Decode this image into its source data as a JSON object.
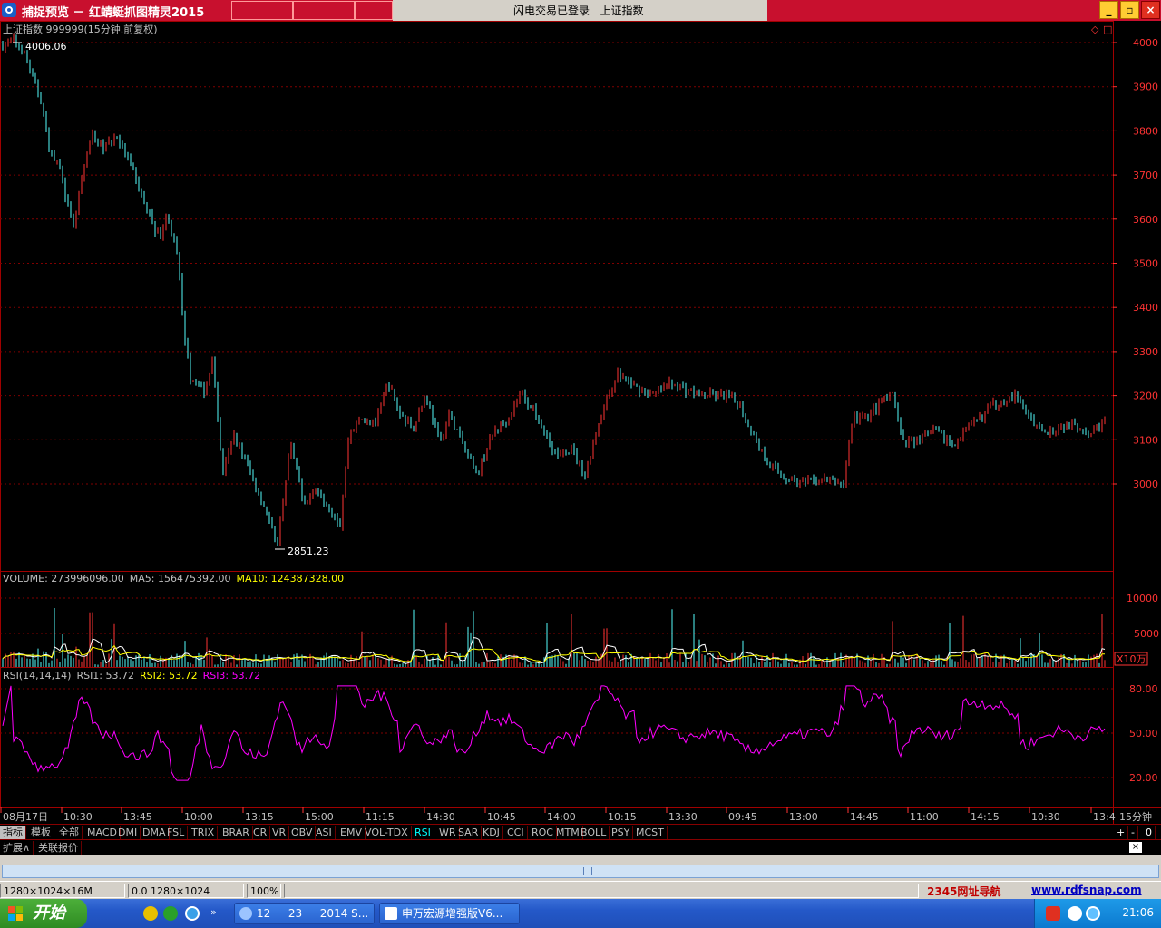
{
  "capture": {
    "title": "捕捉预览 － 红蜻蜓抓图精灵2015"
  },
  "app": {
    "login_status": "闪电交易已登录",
    "index_name": "上证指数",
    "window_buttons": {
      "minimize": "_",
      "restore": "▫",
      "close": "×"
    }
  },
  "main_chart": {
    "header": "上证指数 999999(15分钟.前复权)",
    "high_label": "4006.06",
    "low_label": "2851.23",
    "y_ticks": [
      "4000",
      "3900",
      "3800",
      "3700",
      "3600",
      "3500",
      "3400",
      "3300",
      "3200",
      "3100",
      "3000"
    ],
    "corner_icons": [
      "◇",
      "□"
    ]
  },
  "volume_panel": {
    "label": "VOLUME: 273996096.00",
    "ma5_label": "MA5: 156475392.00",
    "ma10_label": "MA10: 124387328.00",
    "y_ticks": [
      "10000",
      "5000"
    ],
    "unit": "X10万"
  },
  "rsi_panel": {
    "label": "RSI(14,14,14)",
    "rsi1_label": "RSI1: 53.72",
    "rsi2_label": "RSI2: 53.72",
    "rsi3_label": "RSI3: 53.72",
    "y_ticks": [
      "80.00",
      "50.00",
      "20.00"
    ]
  },
  "time_axis": {
    "labels": [
      "08月17日",
      "10:30",
      "13:45",
      "10:00",
      "13:15",
      "15:00",
      "11:15",
      "14:30",
      "10:45",
      "14:00",
      "10:15",
      "13:30",
      "09:45",
      "13:00",
      "14:45",
      "11:00",
      "14:15",
      "10:30",
      "13:4"
    ],
    "period": "15分钟"
  },
  "indicator_tabs": [
    "指标",
    "模板",
    "全部",
    "MACD",
    "DMI",
    "DMA",
    "FSL",
    "TRIX",
    "BRAR",
    "CR",
    "VR",
    "OBV",
    "ASI",
    "EMV",
    "VOL-TDX",
    "RSI",
    "WR",
    "SAR",
    "KDJ",
    "CCI",
    "ROC",
    "MTM",
    "BOLL",
    "PSY",
    "MCST"
  ],
  "selected_indicator": "RSI",
  "indicator_controls": [
    "+",
    "-",
    "0"
  ],
  "extension_tabs": [
    "扩展∧",
    "关联报价"
  ],
  "status_bar": {
    "size_info": "1280×1024×16M",
    "coord_info": "0.0 1280×1024",
    "zoom": "100%",
    "nav_link": "2345网址导航",
    "site_link": "www.rdfsnap.com"
  },
  "taskbar": {
    "start_label": "开始",
    "windows": [
      "12 － 23 － 2014 S...",
      "申万宏源增强版V6..."
    ],
    "clock": "21:06"
  },
  "colors": {
    "up": "#ff3333",
    "down": "#54fcfc",
    "grid": "#800000",
    "ma5": "#ffffff",
    "ma10": "#ffff00",
    "rsi": "#ff00ff"
  }
}
